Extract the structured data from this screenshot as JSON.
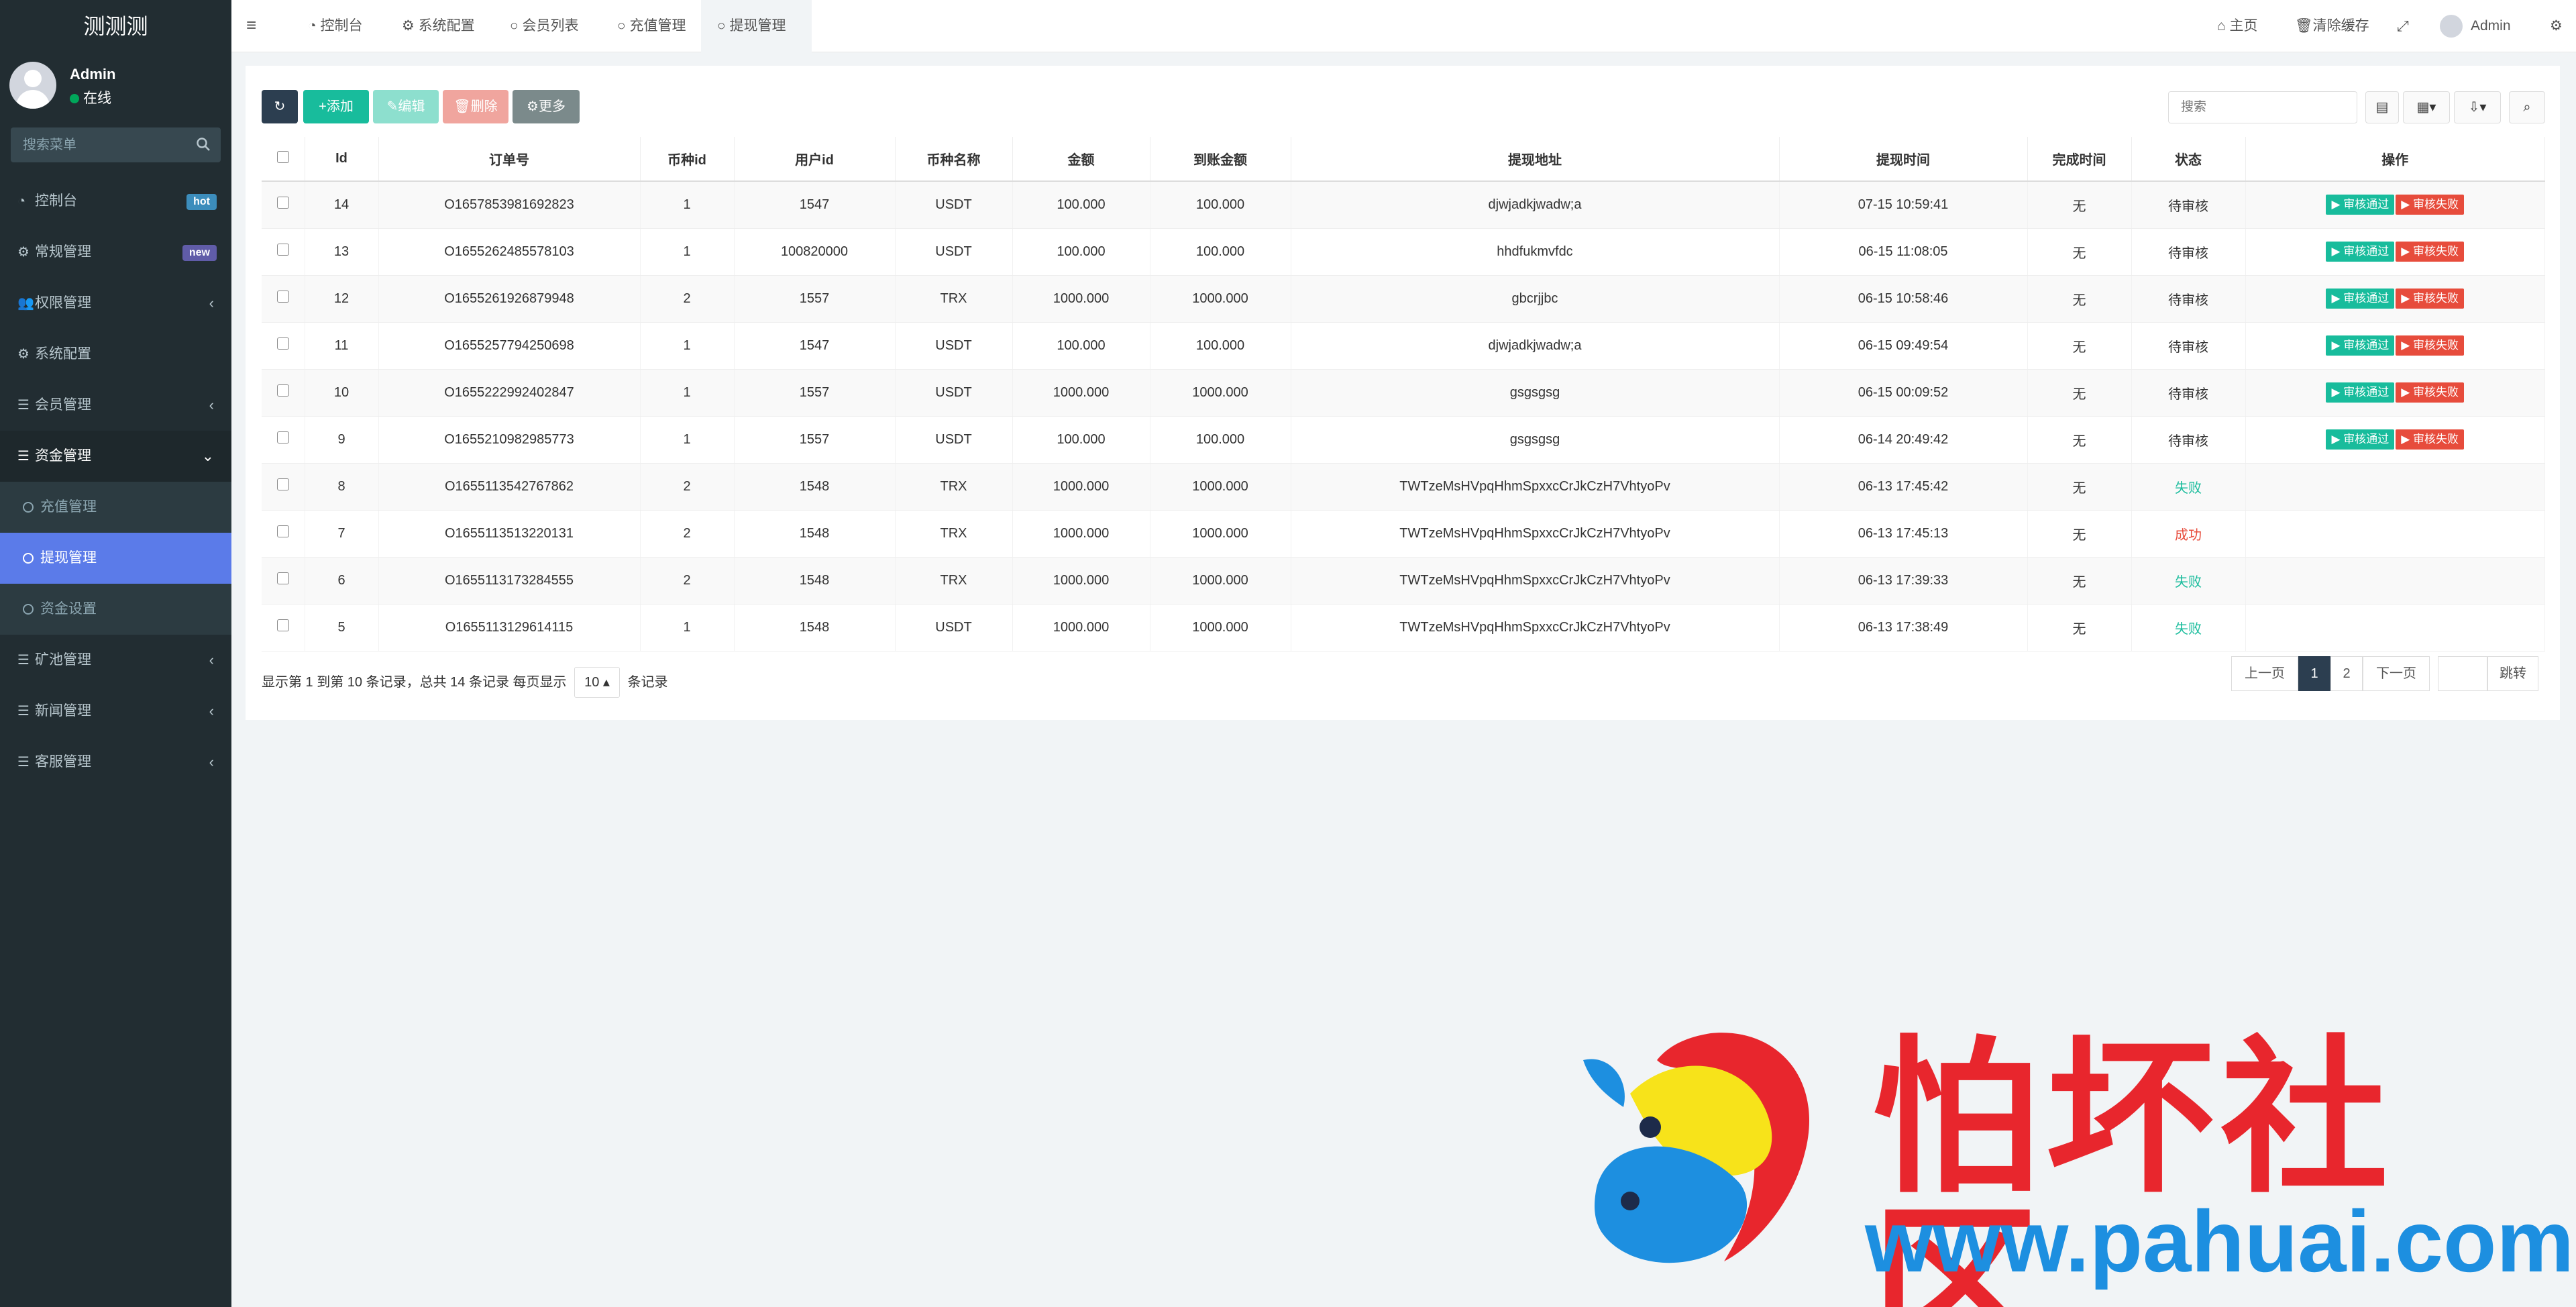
{
  "app": {
    "logo": "测测测"
  },
  "user": {
    "name": "Admin",
    "status": "在线"
  },
  "sidebar": {
    "search_placeholder": "搜索菜单",
    "items": [
      {
        "label": "控制台",
        "badge": "hot",
        "badge_color": "#3c8dbc"
      },
      {
        "label": "常规管理",
        "badge": "new",
        "badge_color": "#605ca8"
      },
      {
        "label": "权限管理"
      },
      {
        "label": "系统配置"
      },
      {
        "label": "会员管理"
      },
      {
        "label": "资金管理"
      },
      {
        "label": "矿池管理"
      },
      {
        "label": "新闻管理"
      },
      {
        "label": "客服管理"
      }
    ],
    "sub_items": [
      {
        "label": "充值管理"
      },
      {
        "label": "提现管理"
      },
      {
        "label": "资金设置"
      }
    ]
  },
  "topbar": {
    "tabs": [
      "控制台",
      "系统配置",
      "会员列表",
      "充值管理",
      "提现管理"
    ],
    "home": "主页",
    "clear_cache": "清除缓存",
    "admin": "Admin"
  },
  "toolbar": {
    "add": "添加",
    "edit": "编辑",
    "delete": "删除",
    "more": "更多",
    "search_placeholder": "搜索"
  },
  "table": {
    "headers": [
      "Id",
      "订单号",
      "币种id",
      "用户id",
      "币种名称",
      "金额",
      "到账金额",
      "提现地址",
      "提现时间",
      "完成时间",
      "状态",
      "操作"
    ],
    "rows": [
      {
        "id": "14",
        "order": "O1657853981692823",
        "coin_id": "1",
        "uid": "1547",
        "coin": "USDT",
        "amount": "100.000",
        "received": "100.000",
        "address": "djwjadkjwadw;a",
        "time": "07-15 10:59:41",
        "done": "无",
        "status": "待审核",
        "status_type": "wait"
      },
      {
        "id": "13",
        "order": "O1655262485578103",
        "coin_id": "1",
        "uid": "100820000",
        "coin": "USDT",
        "amount": "100.000",
        "received": "100.000",
        "address": "hhdfukmvfdc",
        "time": "06-15 11:08:05",
        "done": "无",
        "status": "待审核",
        "status_type": "wait"
      },
      {
        "id": "12",
        "order": "O1655261926879948",
        "coin_id": "2",
        "uid": "1557",
        "coin": "TRX",
        "amount": "1000.000",
        "received": "1000.000",
        "address": "gbcrjjbc",
        "time": "06-15 10:58:46",
        "done": "无",
        "status": "待审核",
        "status_type": "wait"
      },
      {
        "id": "11",
        "order": "O1655257794250698",
        "coin_id": "1",
        "uid": "1547",
        "coin": "USDT",
        "amount": "100.000",
        "received": "100.000",
        "address": "djwjadkjwadw;a",
        "time": "06-15 09:49:54",
        "done": "无",
        "status": "待审核",
        "status_type": "wait"
      },
      {
        "id": "10",
        "order": "O1655222992402847",
        "coin_id": "1",
        "uid": "1557",
        "coin": "USDT",
        "amount": "1000.000",
        "received": "1000.000",
        "address": "gsgsgsg",
        "time": "06-15 00:09:52",
        "done": "无",
        "status": "待审核",
        "status_type": "wait"
      },
      {
        "id": "9",
        "order": "O1655210982985773",
        "coin_id": "1",
        "uid": "1557",
        "coin": "USDT",
        "amount": "100.000",
        "received": "100.000",
        "address": "gsgsgsg",
        "time": "06-14 20:49:42",
        "done": "无",
        "status": "待审核",
        "status_type": "wait"
      },
      {
        "id": "8",
        "order": "O1655113542767862",
        "coin_id": "2",
        "uid": "1548",
        "coin": "TRX",
        "amount": "1000.000",
        "received": "1000.000",
        "address": "TWTzeMsHVpqHhmSpxxcCrJkCzH7VhtyoPv",
        "time": "06-13 17:45:42",
        "done": "无",
        "status": "失败",
        "status_type": "fail"
      },
      {
        "id": "7",
        "order": "O1655113513220131",
        "coin_id": "2",
        "uid": "1548",
        "coin": "TRX",
        "amount": "1000.000",
        "received": "1000.000",
        "address": "TWTzeMsHVpqHhmSpxxcCrJkCzH7VhtyoPv",
        "time": "06-13 17:45:13",
        "done": "无",
        "status": "成功",
        "status_type": "ok"
      },
      {
        "id": "6",
        "order": "O1655113173284555",
        "coin_id": "2",
        "uid": "1548",
        "coin": "TRX",
        "amount": "1000.000",
        "received": "1000.000",
        "address": "TWTzeMsHVpqHhmSpxxcCrJkCzH7VhtyoPv",
        "time": "06-13 17:39:33",
        "done": "无",
        "status": "失败",
        "status_type": "fail"
      },
      {
        "id": "5",
        "order": "O1655113129614115",
        "coin_id": "1",
        "uid": "1548",
        "coin": "USDT",
        "amount": "1000.000",
        "received": "1000.000",
        "address": "TWTzeMsHVpqHhmSpxxcCrJkCzH7VhtyoPv",
        "time": "06-13 17:38:49",
        "done": "无",
        "status": "失败",
        "status_type": "fail"
      }
    ],
    "approve_label": "审核通过",
    "reject_label": "审核失败"
  },
  "footer": {
    "summary": "显示第 1 到第 10 条记录，总共 14 条记录 每页显示",
    "page_size": "10",
    "suffix": "条记录",
    "prev": "上一页",
    "pages": [
      "1",
      "2"
    ],
    "next": "下一页",
    "jump": "跳转"
  },
  "watermark": {
    "text": "怕坏社区",
    "url": "www.pahuai.com"
  },
  "colors": {
    "sidebar_bg": "#222d32",
    "active_item": "#5b7be9",
    "primary_dark": "#2c3e50",
    "success": "#18bc9c",
    "danger": "#e74c3c"
  }
}
